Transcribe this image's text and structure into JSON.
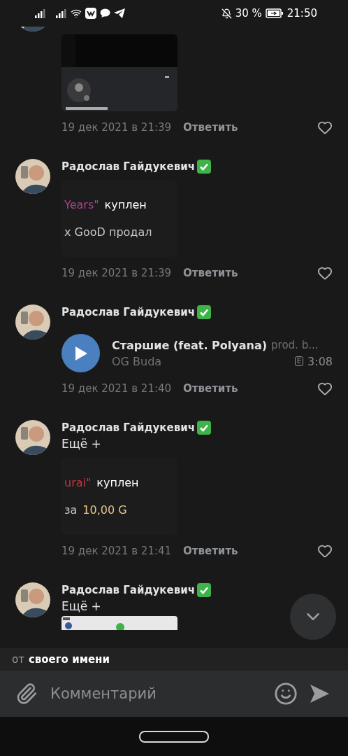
{
  "status_bar": {
    "battery": "30 %",
    "time": "21:50"
  },
  "comments": [
    {
      "date": "19 дек 2021 в 21:39",
      "reply": "Ответить",
      "liked": false
    },
    {
      "author": "Радослав Гайдукевич",
      "verified": true,
      "attachment": {
        "kind": "screenshot",
        "lines": [
          [
            {
              "text": "Years\"",
              "color": "#a8458a"
            },
            {
              "text": "куплен",
              "color": "#ffffff"
            }
          ],
          [
            {
              "text": "x GooD продал",
              "color": "#c8c8c8"
            }
          ]
        ]
      },
      "date": "19 дек 2021 в 21:39",
      "reply": "Ответить",
      "liked": false
    },
    {
      "author": "Радослав Гайдукевич",
      "verified": true,
      "attachment": {
        "kind": "audio",
        "title": "Старшие (feat. Polyana)",
        "subtitle": "prod. b...",
        "artist": "OG Buda",
        "explicit": "E",
        "duration": "3:08"
      },
      "date": "19 дек 2021 в 21:40",
      "reply": "Ответить",
      "liked": false
    },
    {
      "author": "Радослав Гайдукевич",
      "verified": true,
      "text": "Ещё +",
      "attachment": {
        "kind": "screenshot",
        "lines": [
          [
            {
              "text": "urai\"",
              "color": "#c0393b"
            },
            {
              "text": "куплен",
              "color": "#ffffff"
            }
          ],
          [
            {
              "text": "за",
              "color": "#c8c8c8"
            },
            {
              "text": "10,00 G",
              "color": "#e8c48a"
            }
          ]
        ]
      },
      "date": "19 дек 2021 в 21:41",
      "reply": "Ответить",
      "liked": false
    },
    {
      "author": "Радослав Гайдукевич",
      "verified": true,
      "text": "Ещё +",
      "attachment": {
        "kind": "picture_cut"
      }
    }
  ],
  "sender": {
    "prefix": "от",
    "name": "своего имени"
  },
  "composer": {
    "placeholder": "Комментарий"
  }
}
